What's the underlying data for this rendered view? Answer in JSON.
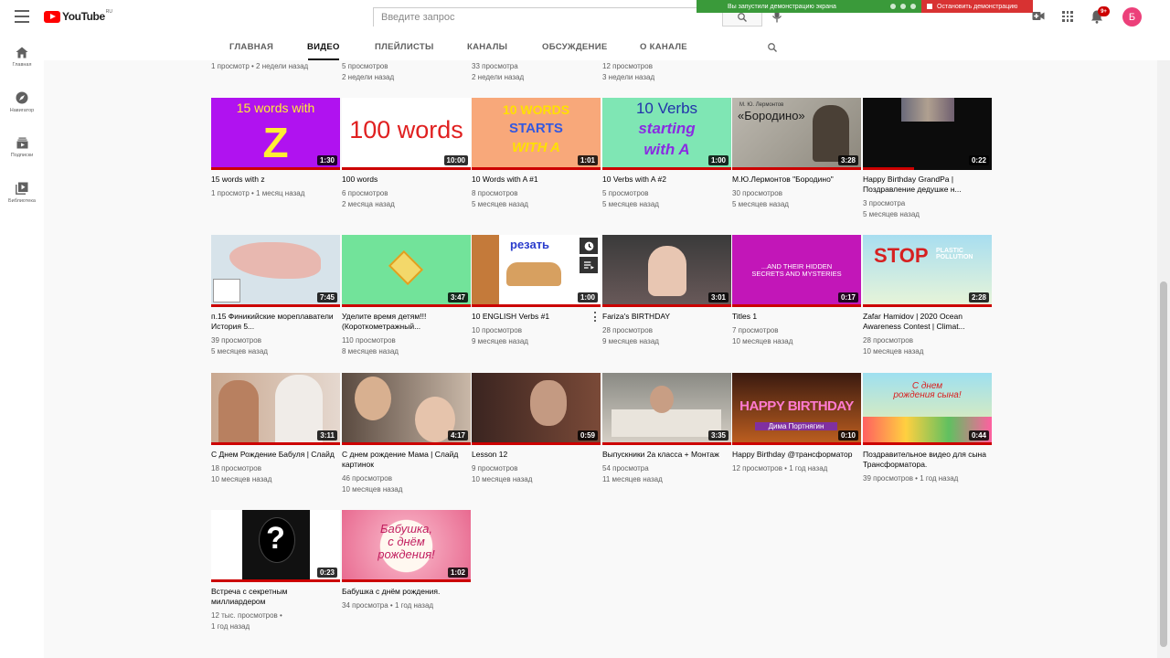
{
  "header": {
    "logo_text": "YouTube",
    "logo_region": "RU",
    "search_placeholder": "Введите запрос",
    "demo_status": "Вы запустили демонстрацию экрана",
    "demo_stop": "Остановить демонстрацию",
    "notification_count": "9+",
    "avatar_letter": "Б"
  },
  "guide": [
    {
      "label": "Главная",
      "icon": "home-icon"
    },
    {
      "label": "Навигатор",
      "icon": "compass-icon"
    },
    {
      "label": "Подписки",
      "icon": "subscriptions-icon"
    },
    {
      "label": "Библиотека",
      "icon": "library-icon"
    }
  ],
  "tabs": [
    {
      "label": "ГЛАВНАЯ"
    },
    {
      "label": "ВИДЕО",
      "active": true
    },
    {
      "label": "ПЛЕЙЛИСТЫ"
    },
    {
      "label": "КАНАЛЫ"
    },
    {
      "label": "ОБСУЖДЕНИЕ"
    },
    {
      "label": "О КАНАЛЕ"
    }
  ],
  "top_partial_meta": [
    {
      "views": "1 просмотр",
      "age": "2 недели назад"
    },
    {
      "views": "5 просмотров",
      "age": "2 недели назад"
    },
    {
      "views": "33 просмотра",
      "age": "2 недели назад"
    },
    {
      "views": "12 просмотров",
      "age": "3 недели назад"
    }
  ],
  "videos": [
    {
      "title": "15 words with z",
      "duration": "1:30",
      "views": "1 просмотр",
      "age": "1 месяц назад",
      "thumb_text": "15 words with",
      "thumb_big": "Z"
    },
    {
      "title": "100 words",
      "duration": "10:00",
      "views": "6 просмотров",
      "age": "2 месяца назад",
      "thumb_text": "100 words"
    },
    {
      "title": "10 Words with A #1",
      "duration": "1:01",
      "views": "8 просмотров",
      "age": "5 месяцев назад",
      "thumb_lines": [
        "10 WORDS",
        "STARTS",
        "WITH A"
      ]
    },
    {
      "title": "10 Verbs with A #2",
      "duration": "1:00",
      "views": "5 просмотров",
      "age": "5 месяцев назад",
      "thumb_lines": [
        "10 Verbs",
        "starting",
        "with A"
      ]
    },
    {
      "title": "М.Ю.Лермонтов \"Бородино\"",
      "duration": "3:28",
      "views": "30 просмотров",
      "age": "5 месяцев назад",
      "thumb_small": "М. Ю. Лермонтов",
      "thumb_text": "«Бородино»"
    },
    {
      "title": "Happy Birthday GrandPa | Поздравление дедушке н...",
      "duration": "0:22",
      "views": "3 просмотра",
      "age": "5 месяцев назад"
    },
    {
      "title": "п.15 Финикийские мореплаватели История 5...",
      "duration": "7:45",
      "views": "39 просмотров",
      "age": "5 месяцев назад"
    },
    {
      "title": "Уделите время детям!!! (Короткометражный...",
      "duration": "3:47",
      "views": "110 просмотров",
      "age": "8 месяцев назад"
    },
    {
      "title": "10 ENGLISH Verbs #1",
      "duration": "1:00",
      "views": "10 просмотров",
      "age": "9 месяцев назад",
      "thumb_text": "резать"
    },
    {
      "title": "Fariza's BIRTHDAY",
      "duration": "3:01",
      "views": "28 просмотров",
      "age": "9 месяцев назад"
    },
    {
      "title": "Titles 1",
      "duration": "0:17",
      "views": "7 просмотров",
      "age": "10 месяцев назад",
      "thumb_text": "...AND THEIR HIDDEN SECRETS AND MYSTERIES"
    },
    {
      "title": "Zafar Hamidov | 2020 Ocean Awareness Contest | Climat...",
      "duration": "2:28",
      "views": "28 просмотров",
      "age": "10 месяцев назад",
      "thumb_text": "STOP",
      "thumb_small": "PLASTIC POLLUTION"
    },
    {
      "title": "С Днем Рождение Бабуля | Слайд",
      "duration": "3:11",
      "views": "18 просмотров",
      "age": "10 месяцев назад"
    },
    {
      "title": "С днем рождение Мама | Слайд картинок",
      "duration": "4:17",
      "views": "46 просмотров",
      "age": "10 месяцев назад"
    },
    {
      "title": "Lesson 12",
      "duration": "0:59",
      "views": "9 просмотров",
      "age": "10 месяцев назад"
    },
    {
      "title": "Выпускники 2а класса + Монтаж",
      "duration": "3:35",
      "views": "54 просмотра",
      "age": "11 месяцев назад"
    },
    {
      "title": "Happy Birthday @трансформатор",
      "duration": "0:10",
      "views": "12 просмотров",
      "age": "1 год назад",
      "thumb_text": "HAPPY BIRTHDAY",
      "thumb_small": "Дима Портнягин"
    },
    {
      "title": "Поздравительное видео для сына Трансформатора.",
      "duration": "0:44",
      "views": "39 просмотров",
      "age": "1 год назад",
      "thumb_text": "С днем рождения сына!"
    },
    {
      "title": "Встреча с секретным миллиардером",
      "duration": "0:23",
      "views": "12 тыс. просмотров",
      "age": "1 год назад",
      "thumb_text": "?"
    },
    {
      "title": "Бабушка с днём рождения.",
      "duration": "1:02",
      "views": "34 просмотра",
      "age": "1 год назад",
      "thumb_text": "Бабушка, с днём рождения!"
    }
  ]
}
